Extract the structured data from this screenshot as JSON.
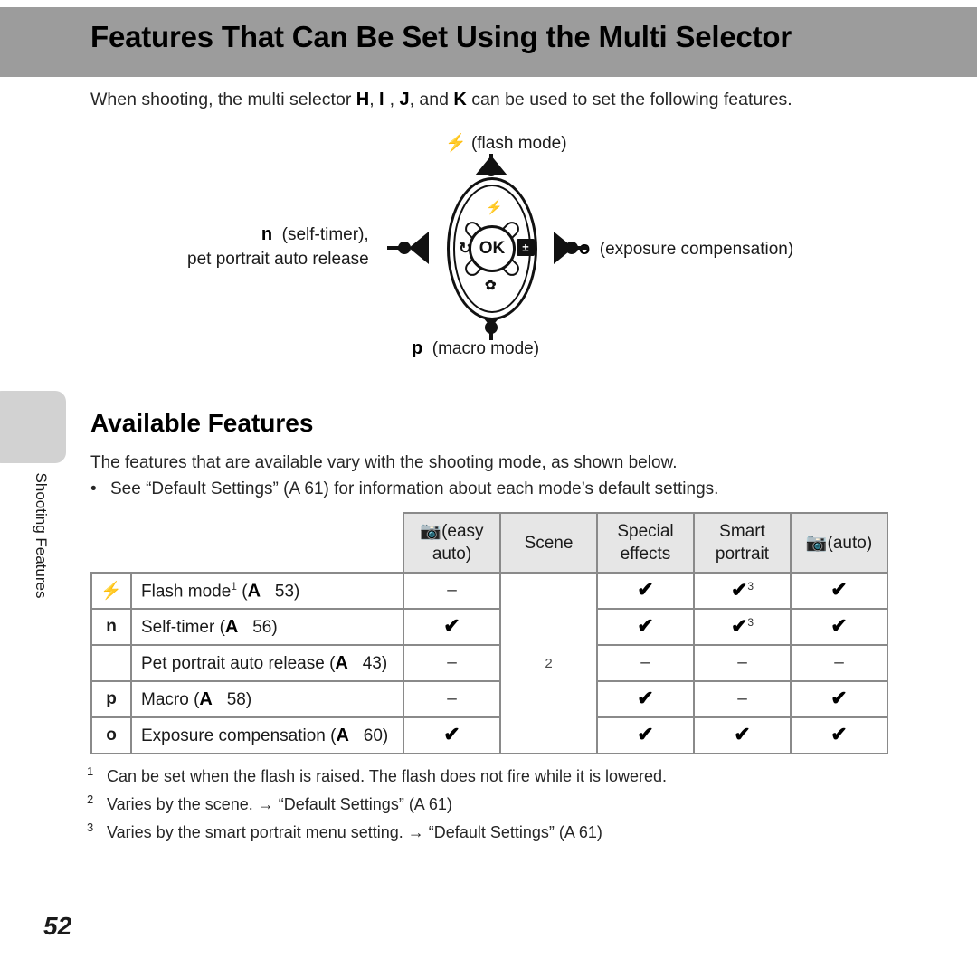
{
  "header": {
    "title": "Features That Can Be Set Using the Multi Selector",
    "band_color": "#9c9c9c"
  },
  "intro": {
    "before": "When shooting, the multi selector",
    "sym1": "H",
    "sep1": ",",
    "sym2": "I",
    "sep2": ",",
    "sym3": "J",
    "sep3": ", and",
    "sym4": "K",
    "after": "can be used to set the following features."
  },
  "diagram": {
    "name": "multi-selector-diagram",
    "ok_label": "OK",
    "top_sym": "⚡",
    "top_label": "(flash mode)",
    "bottom_sym": "p",
    "bottom_label": "(macro mode)",
    "left_sym": "n",
    "left_label_line1": "(self-timer),",
    "left_label_line2": "pet portrait auto release",
    "right_sym": "o",
    "right_label": "(exposure compensation)",
    "dial_icons": {
      "flash": "⚡",
      "self_timer": "⏱",
      "macro": "⚘",
      "exposure": "±"
    }
  },
  "sidebar": {
    "tab_label": "Shooting Features",
    "tab_color": "#d2d2d2"
  },
  "section": {
    "title": "Available Features",
    "intro": "The features that are available vary with the shooting mode, as shown below.",
    "bullet": "See “Default Settings” (A    61) for information about each mode’s default settings."
  },
  "table": {
    "headers": [
      {
        "sym": "▣",
        "label": "(easy\nauto)",
        "line1": "(easy",
        "line2": "auto)",
        "has_sym": true
      },
      {
        "sym": "",
        "label": "Scene",
        "line1": "Scene",
        "line2": "",
        "has_sym": false
      },
      {
        "sym": "",
        "label": "Special effects",
        "line1": "Special",
        "line2": "effects",
        "has_sym": false
      },
      {
        "sym": "",
        "label": "Smart portrait",
        "line1": "Smart",
        "line2": "portrait",
        "has_sym": false
      },
      {
        "sym": "●",
        "label": "(auto)",
        "line1": "(auto)",
        "line2": "",
        "has_sym": true
      }
    ],
    "rows": [
      {
        "icon": "⚡",
        "name": "Flash mode",
        "name_sup": "1",
        "ref_sym": "A",
        "ref_page": "53",
        "easy_auto": "–",
        "special_effects": "✔",
        "special_effects_sup": "",
        "smart_portrait": "✔",
        "smart_portrait_sup": "3",
        "auto": "✔"
      },
      {
        "icon": "n",
        "name": "Self-timer",
        "name_sup": "",
        "ref_sym": "A",
        "ref_page": "56",
        "easy_auto": "✔",
        "special_effects": "✔",
        "special_effects_sup": "",
        "smart_portrait": "✔",
        "smart_portrait_sup": "3",
        "auto": "✔"
      },
      {
        "icon": "",
        "name": "Pet portrait auto release",
        "name_sup": "",
        "ref_sym": "A",
        "ref_page": "43",
        "easy_auto": "–",
        "special_effects": "–",
        "special_effects_sup": "",
        "smart_portrait": "–",
        "smart_portrait_sup": "",
        "auto": "–"
      },
      {
        "icon": "p",
        "name": "Macro",
        "name_sup": "",
        "ref_sym": "A",
        "ref_page": "58",
        "easy_auto": "–",
        "special_effects": "✔",
        "special_effects_sup": "",
        "smart_portrait": "–",
        "smart_portrait_sup": "",
        "auto": "✔"
      },
      {
        "icon": "o",
        "name": "Exposure compensation",
        "name_sup": "",
        "ref_sym": "A",
        "ref_page": "60",
        "easy_auto": "✔",
        "special_effects": "✔",
        "special_effects_sup": "",
        "smart_portrait": "✔",
        "smart_portrait_sup": "",
        "auto": "✔"
      }
    ],
    "scene_cell_mark": "2"
  },
  "footnotes": [
    {
      "num": "1",
      "text": "Can be set when the flash is raised. The flash does not fire while it is lowered."
    },
    {
      "num": "2",
      "text": "Varies by the scene. → “Default Settings” (A    61)"
    },
    {
      "num": "3",
      "text": "Varies by the smart portrait menu setting. → “Default Settings” (A    61)"
    }
  ],
  "page_number": "52"
}
